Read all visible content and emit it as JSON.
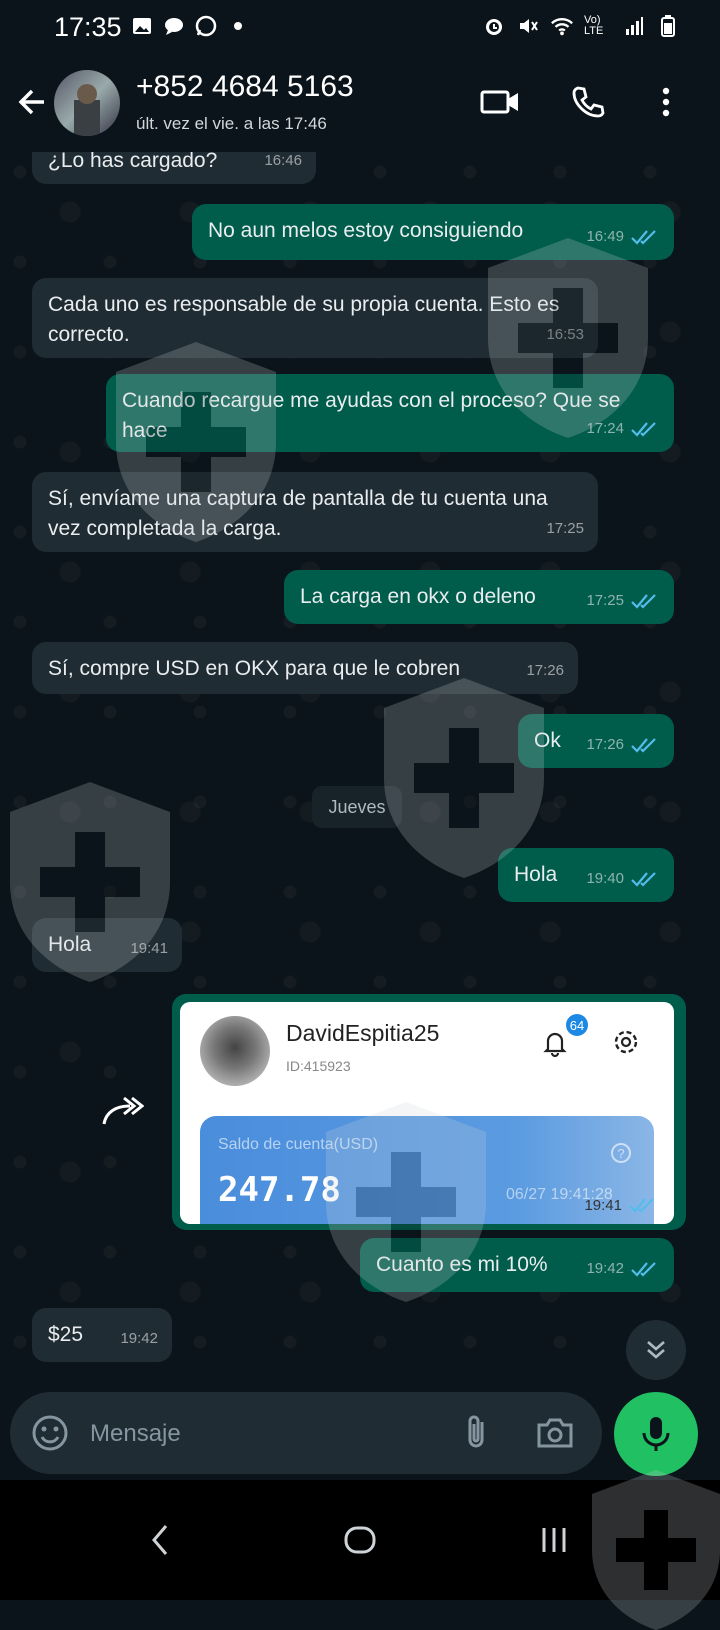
{
  "status_bar": {
    "time": "17:35",
    "network": "Vo) LTE"
  },
  "header": {
    "contact": "+852 4684 5163",
    "last_seen": "últ. vez el vie. a las 17:46"
  },
  "messages": [
    {
      "dir": "in",
      "text": "¿Lo has cargado?",
      "time": "16:46"
    },
    {
      "dir": "out",
      "text": "No aun melos estoy consiguiendo",
      "time": "16:49",
      "status": "read"
    },
    {
      "dir": "in",
      "text": "Cada uno es responsable de su propia cuenta. Esto es correcto.",
      "time": "16:53"
    },
    {
      "dir": "out",
      "text": "Cuando recargue  me ayudas con el proceso? Que se hace",
      "time": "17:24",
      "status": "read"
    },
    {
      "dir": "in",
      "text": "Sí, envíame una captura de pantalla de tu cuenta una vez completada la carga.",
      "time": "17:25"
    },
    {
      "dir": "out",
      "text": "La carga en okx o deleno",
      "time": "17:25",
      "status": "read"
    },
    {
      "dir": "in",
      "text": "Sí, compre USD en OKX para que le cobren",
      "time": "17:26"
    },
    {
      "dir": "out",
      "text": "Ok",
      "time": "17:26",
      "status": "read"
    },
    {
      "dir": "out",
      "text": "Hola",
      "time": "19:40",
      "status": "read"
    },
    {
      "dir": "in",
      "text": "Hola",
      "time": "19:41"
    },
    {
      "dir": "out",
      "text": "Cuanto es mi 10%",
      "time": "19:42",
      "status": "read"
    },
    {
      "dir": "in",
      "text": "$25",
      "time": "19:42"
    }
  ],
  "date_divider": "Jueves",
  "image_message": {
    "username": "DavidEspitia25",
    "user_id": "ID:415923",
    "notification_count": "64",
    "balance_label": "Saldo de cuenta(USD)",
    "balance": "247.78",
    "screenshot_time": "06/27 19:41:28",
    "time": "19:41",
    "status": "read"
  },
  "composer": {
    "placeholder": "Mensaje"
  },
  "colors": {
    "incoming": "#202c33",
    "outgoing": "#005c4b",
    "accent": "#21c063",
    "read_ticks": "#53bdeb"
  },
  "icons": [
    "back-arrow-icon",
    "video-call-icon",
    "phone-icon",
    "more-vert-icon",
    "forward-icon",
    "bell-icon",
    "gear-icon",
    "scroll-down-icon",
    "emoji-icon",
    "attach-icon",
    "camera-icon",
    "mic-icon"
  ]
}
